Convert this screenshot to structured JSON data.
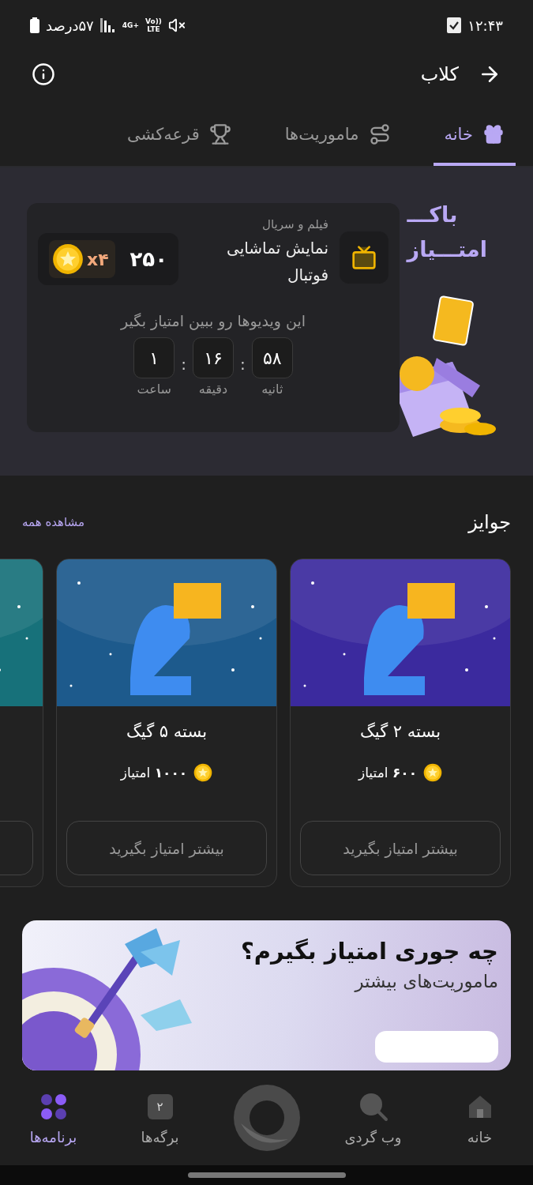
{
  "status_bar": {
    "time": "۱۲:۴۳",
    "battery": "۵۷درصد",
    "network": "4G+",
    "volte_top": "Vo))",
    "volte_bottom": "LTE"
  },
  "header": {
    "title": "کلاب"
  },
  "tabs": [
    {
      "label": "خانه",
      "selected": true,
      "kind": "gift"
    },
    {
      "label": "ماموریت‌ها",
      "selected": false,
      "kind": "route"
    },
    {
      "label": "قرعه‌کشی",
      "selected": false,
      "kind": "trophy"
    }
  ],
  "banner": {
    "heading": [
      "باکـــ",
      "امتـــیاز"
    ],
    "task": {
      "category": "فیلم و سریال",
      "title": "نمایش تماشایی فوتبال",
      "points": "۲۵۰",
      "multiplier": "x۴",
      "hint": "این ویدیوها رو ببین امتیاز بگیر",
      "separator": ":",
      "countdown": [
        {
          "value": "۵۸",
          "unit": "ثانیه"
        },
        {
          "value": "۱۶",
          "unit": "دقیقه"
        },
        {
          "value": "۱",
          "unit": "ساعت"
        }
      ]
    }
  },
  "prizes": {
    "title": "جوایز",
    "link": "مشاهده همه",
    "items": [
      {
        "color": "#3b2a9e",
        "title": "بسته ۲ گیگ",
        "points": "**۶۰۰** امتیاز",
        "button": "بیشتر امتیاز بگیرید"
      },
      {
        "color": "#1d5a8c",
        "title": "بسته ۵ گیگ",
        "points": "**۱۰۰۰** امتیاز",
        "button": "بیشتر امتیاز بگیرید"
      },
      {
        "color": "#17717a"
      }
    ]
  },
  "promo": {
    "title": "چه جوری امتیاز بگیرم؟",
    "subtitle": "ماموریت‌های بیشتر"
  },
  "bottom_nav": [
    {
      "kind": "home",
      "label": "خانه",
      "selected": false
    },
    {
      "kind": "search",
      "label": "وب گردی",
      "selected": false
    },
    {
      "kind": "logo",
      "selected": false
    },
    {
      "kind": "tabs",
      "label": "برگه‌ها",
      "badge": "۲",
      "selected": false
    },
    {
      "kind": "apps",
      "label": "برنامه‌ها",
      "selected": true
    }
  ]
}
